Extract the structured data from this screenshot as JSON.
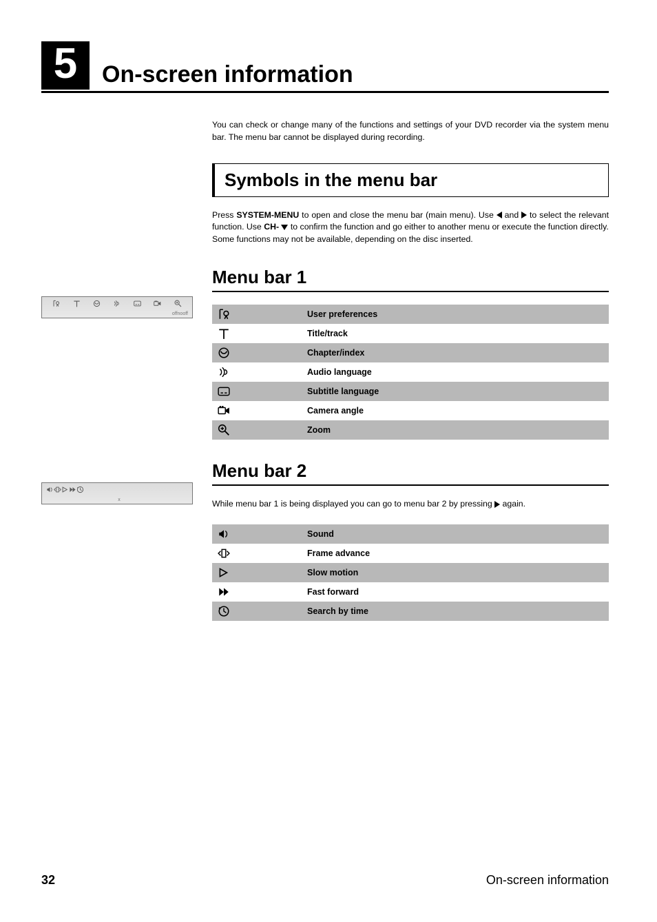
{
  "chapter": {
    "number": "5",
    "title": "On-screen information"
  },
  "intro": "You can check or change many of the functions and settings of your DVD recorder via the system menu bar. The menu bar cannot be displayed during recording.",
  "section_symbols": {
    "title": "Symbols in the menu bar"
  },
  "symbols_text": {
    "p1a": "Press ",
    "key1": "SYSTEM-MENU",
    "p1b": " to open and close the menu bar (main menu). Use ",
    "p1c": " and ",
    "p1d": " to select the relevant function. Use ",
    "key2": "CH-",
    "p1e": " to confirm the function and go either to another menu or execute the function directly.",
    "p2": "Some functions may not be available, depending on the disc inserted."
  },
  "menubar1": {
    "title": "Menu bar 1",
    "rows": [
      {
        "icon": "userpref",
        "label": "User preferences"
      },
      {
        "icon": "title",
        "label": "Title/track"
      },
      {
        "icon": "chapter",
        "label": "Chapter/index"
      },
      {
        "icon": "audio",
        "label": "Audio language"
      },
      {
        "icon": "subtitle",
        "label": "Subtitle language"
      },
      {
        "icon": "camera",
        "label": "Camera angle"
      },
      {
        "icon": "zoom",
        "label": "Zoom"
      }
    ]
  },
  "menubar2": {
    "title": "Menu bar 2",
    "intro_a": "While menu bar 1 is being displayed you can go to menu bar 2 by pressing ",
    "intro_b": " again.",
    "rows": [
      {
        "icon": "sound",
        "label": "Sound"
      },
      {
        "icon": "frame",
        "label": "Frame advance"
      },
      {
        "icon": "slow",
        "label": "Slow motion"
      },
      {
        "icon": "ffwd",
        "label": "Fast forward"
      },
      {
        "icon": "time",
        "label": "Search by time"
      }
    ]
  },
  "footer": {
    "page": "32",
    "title": "On-screen information"
  },
  "side1_labels": [
    "off",
    "no",
    "off"
  ],
  "side2_label": "x"
}
